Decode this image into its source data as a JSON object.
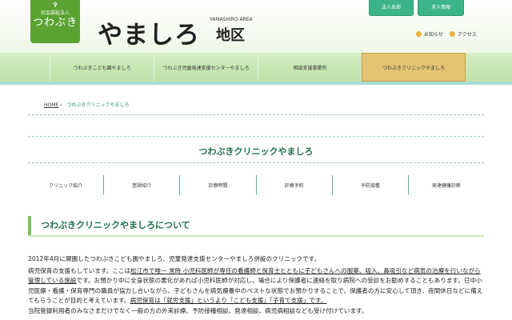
{
  "header": {
    "logo_small": "社会福祉法人",
    "logo_big": "つわぶき",
    "area_name": "やましろ",
    "area_sub": "YAMASHIRO AREA",
    "area_kanji": "地区",
    "top_buttons": [
      "法人本部",
      "求人情報"
    ],
    "utility_links": [
      "お知らせ",
      "アクセス"
    ]
  },
  "nav": {
    "items": [
      "つわぶきこども園やましろ",
      "つわぶき児童発達支援センターやましろ",
      "相談支援事業所",
      "つわぶきクリニックやましろ"
    ]
  },
  "breadcrumb": {
    "home": "HOME",
    "separator": "›",
    "current": "つわぶきクリニックやましろ"
  },
  "page": {
    "title": "つわぶきクリニックやましろ",
    "subnav": [
      "クリニック紹介",
      "医師紹介",
      "診療時間",
      "診療予約",
      "予防接種",
      "発達健康診断"
    ],
    "section_heading": "つわぶきクリニックやましろについて",
    "p1": "2012年4月に開園したつわぶきこども園やましろ、児童発達支援センターやましろ併設のクリニックです。",
    "p2_a": "病児保育の支援もしています。ここは",
    "p2_u1": "松江市で唯一 常時 小児科医師が専任の看護師と保育士とともに子どもさんへの服薬、吸入、鼻吸引など病気の治療を行いながら管理している施設",
    "p2_b": "です。お預かり中に全身状態の悪化があれば小児科医師が対応し、場合により保護者に連絡を取り病院への受診をお勧めすることもあります。日中小児医療・看護・保育専門の職員が協力し合いながら、子どもさんを病気療養中のベストな状態でお預かりすることで、保護者の方に安心して頂き、夜間休日などに備えてもらうことが目的と考えています。",
    "p2_u2": "病児保育は「就労支援」というより「こども支援」「子育て支援」です。",
    "p3": "当院登録利用者のみなさまだけでなく一般の方の外来診療、予防接種相談、発達相談、病児病相談なども受け付けています。"
  },
  "colors": {
    "brand_green": "#5aa332",
    "accent_teal": "#3cb489",
    "active_tab": "#e4c372",
    "title_green": "#1f6f4a"
  }
}
